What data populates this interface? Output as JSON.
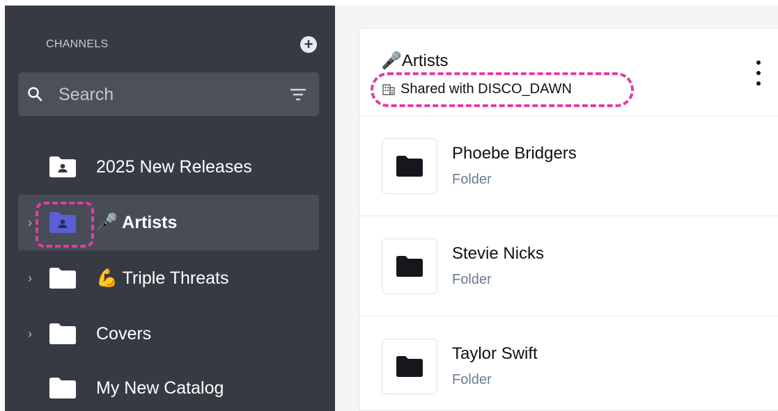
{
  "sidebar": {
    "section_title": "CHANNELS",
    "add_icon": "plus-circle-icon",
    "search": {
      "placeholder": "Search",
      "value": ""
    },
    "items": [
      {
        "label": "2025 New Releases",
        "icon": "person-folder-icon",
        "has_chevron": false,
        "emoji": ""
      },
      {
        "label": "Artists",
        "icon": "person-folder-icon",
        "has_chevron": true,
        "emoji": "🎤",
        "active": true
      },
      {
        "label": "Triple Threats",
        "icon": "folder-icon",
        "has_chevron": true,
        "emoji": "💪"
      },
      {
        "label": "Covers",
        "icon": "folder-icon",
        "has_chevron": true,
        "emoji": ""
      },
      {
        "label": "My New Catalog",
        "icon": "folder-icon",
        "has_chevron": false,
        "emoji": ""
      }
    ]
  },
  "main": {
    "title_emoji": "🎤",
    "title": "Artists",
    "shared_label": "Shared with DISCO_DAWN",
    "rows": [
      {
        "name": "Phoebe Bridgers",
        "type": "Folder"
      },
      {
        "name": "Stevie Nicks",
        "type": "Folder"
      },
      {
        "name": "Taylor Swift",
        "type": "Folder"
      }
    ]
  },
  "colors": {
    "sidebar_bg": "#363a43",
    "active_item_bg": "#474c56",
    "accent_folder": "#5a5fd6",
    "highlight_dashed": "#e43d9f"
  }
}
